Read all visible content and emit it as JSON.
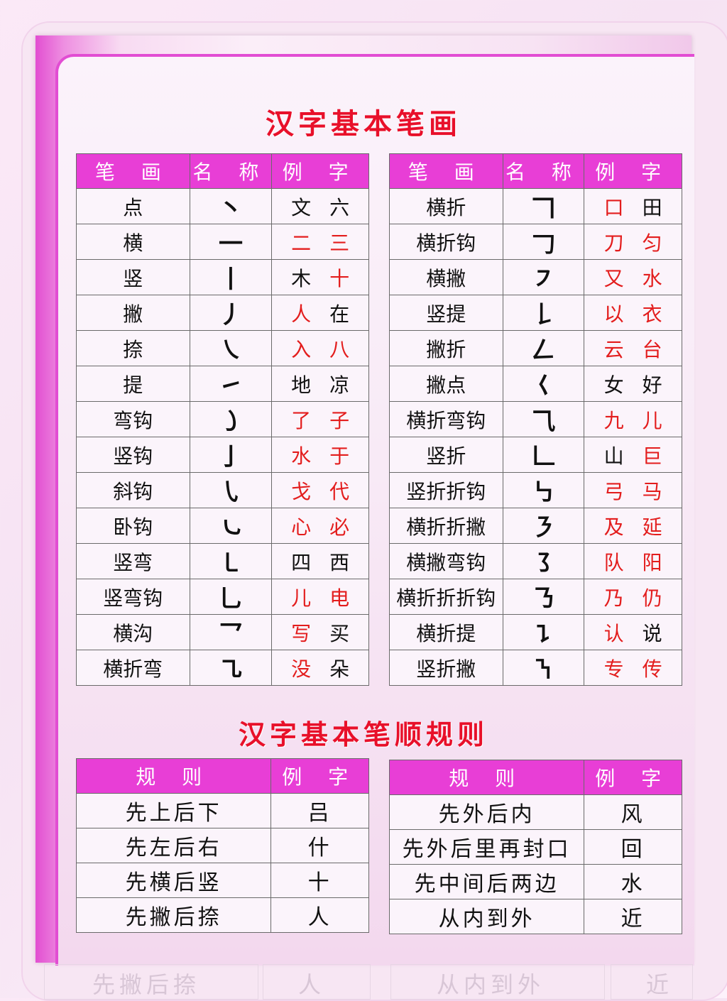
{
  "titles": {
    "strokes": "汉字基本笔画",
    "rules": "汉字基本笔顺规则"
  },
  "stroke_headers": [
    "笔 画",
    "名 称",
    "例 字"
  ],
  "strokes_left": [
    {
      "name": "点",
      "glyph": "丶",
      "ex1": "文",
      "ex2": "六",
      "ex1_red": false,
      "ex2_red": false
    },
    {
      "name": "横",
      "glyph": "一",
      "ex1": "二",
      "ex2": "三",
      "ex1_red": true,
      "ex2_red": true
    },
    {
      "name": "竖",
      "glyph": "丨",
      "ex1": "木",
      "ex2": "十",
      "ex1_red": false,
      "ex2_red": true
    },
    {
      "name": "撇",
      "glyph": "丿",
      "ex1": "人",
      "ex2": "在",
      "ex1_red": true,
      "ex2_red": false
    },
    {
      "name": "捺",
      "glyph": "㇏",
      "ex1": "入",
      "ex2": "八",
      "ex1_red": true,
      "ex2_red": true
    },
    {
      "name": "提",
      "glyph": "㇀",
      "ex1": "地",
      "ex2": "凉",
      "ex1_red": false,
      "ex2_red": false
    },
    {
      "name": "弯钩",
      "glyph": "㇁",
      "ex1": "了",
      "ex2": "子",
      "ex1_red": true,
      "ex2_red": true
    },
    {
      "name": "竖钩",
      "glyph": "亅",
      "ex1": "水",
      "ex2": "于",
      "ex1_red": true,
      "ex2_red": true
    },
    {
      "name": "斜钩",
      "glyph": "㇂",
      "ex1": "戈",
      "ex2": "代",
      "ex1_red": true,
      "ex2_red": true
    },
    {
      "name": "卧钩",
      "glyph": "㇃",
      "ex1": "心",
      "ex2": "必",
      "ex1_red": true,
      "ex2_red": true
    },
    {
      "name": "竖弯",
      "glyph": "㇄",
      "ex1": "四",
      "ex2": "西",
      "ex1_red": false,
      "ex2_red": false
    },
    {
      "name": "竖弯钩",
      "glyph": "乚",
      "ex1": "儿",
      "ex2": "电",
      "ex1_red": true,
      "ex2_red": true
    },
    {
      "name": "横沟",
      "glyph": "乛",
      "ex1": "写",
      "ex2": "买",
      "ex1_red": true,
      "ex2_red": false
    },
    {
      "name": "横折弯",
      "glyph": "㇈",
      "ex1": "没",
      "ex2": "朵",
      "ex1_red": true,
      "ex2_red": false
    }
  ],
  "strokes_right": [
    {
      "name": "横折",
      "glyph": "𠃍",
      "ex1": "口",
      "ex2": "田",
      "ex1_red": true,
      "ex2_red": false
    },
    {
      "name": "横折钩",
      "glyph": "𠃌",
      "ex1": "刀",
      "ex2": "匀",
      "ex1_red": true,
      "ex2_red": true
    },
    {
      "name": "横撇",
      "glyph": "㇇",
      "ex1": "又",
      "ex2": "水",
      "ex1_red": true,
      "ex2_red": true
    },
    {
      "name": "竖提",
      "glyph": "𠄌",
      "ex1": "以",
      "ex2": "衣",
      "ex1_red": true,
      "ex2_red": true
    },
    {
      "name": "撇折",
      "glyph": "𠃋",
      "ex1": "云",
      "ex2": "台",
      "ex1_red": true,
      "ex2_red": true
    },
    {
      "name": "撇点",
      "glyph": "𡿨",
      "ex1": "女",
      "ex2": "好",
      "ex1_red": false,
      "ex2_red": false
    },
    {
      "name": "横折弯钩",
      "glyph": "⺄",
      "ex1": "九",
      "ex2": "儿",
      "ex1_red": true,
      "ex2_red": true
    },
    {
      "name": "竖折",
      "glyph": "𠃊",
      "ex1": "山",
      "ex2": "巨",
      "ex1_red": false,
      "ex2_red": true
    },
    {
      "name": "竖折折钩",
      "glyph": "㇉",
      "ex1": "弓",
      "ex2": "马",
      "ex1_red": true,
      "ex2_red": true
    },
    {
      "name": "横折折撇",
      "glyph": "㇋",
      "ex1": "及",
      "ex2": "延",
      "ex1_red": true,
      "ex2_red": true
    },
    {
      "name": "横撇弯钩",
      "glyph": "㇌",
      "ex1": "队",
      "ex2": "阳",
      "ex1_red": true,
      "ex2_red": true
    },
    {
      "name": "横折折折钩",
      "glyph": "㇡",
      "ex1": "乃",
      "ex2": "仍",
      "ex1_red": true,
      "ex2_red": true
    },
    {
      "name": "横折提",
      "glyph": "㇊",
      "ex1": "认",
      "ex2": "说",
      "ex1_red": true,
      "ex2_red": false
    },
    {
      "name": "竖折撇",
      "glyph": "㇎",
      "ex1": "专",
      "ex2": "传",
      "ex1_red": true,
      "ex2_red": true
    }
  ],
  "rule_headers": [
    "规 则",
    "例 字"
  ],
  "rules_left": [
    {
      "rule": "先上后下",
      "example": "吕"
    },
    {
      "rule": "先左后右",
      "example": "什"
    },
    {
      "rule": "先横后竖",
      "example": "十"
    },
    {
      "rule": "先撇后捺",
      "example": "人"
    }
  ],
  "rules_right": [
    {
      "rule": "先外后内",
      "example": "风"
    },
    {
      "rule": "先外后里再封口",
      "example": "回"
    },
    {
      "rule": "先中间后两边",
      "example": "水"
    },
    {
      "rule": "从内到外",
      "example": "近"
    }
  ],
  "reflection": {
    "left_rule": "先撇后捺",
    "left_example": "人",
    "right_rule": "从内到外",
    "right_example": "近"
  },
  "colors": {
    "header": "#e83ed6",
    "title": "#e8102a",
    "red_example": "#e31d1d",
    "frame": "#e24dd3"
  }
}
